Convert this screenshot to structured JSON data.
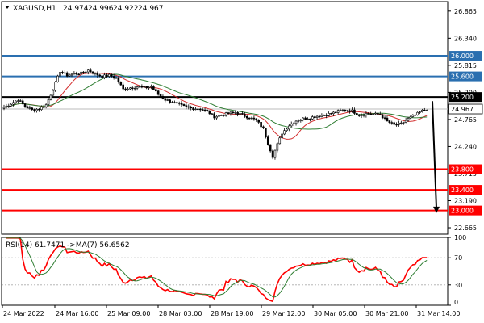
{
  "chart_data": {
    "type": "candlestick",
    "symbol": "XAGUSD,H1",
    "ohlc_header": {
      "open": "24.974",
      "high": "24.996",
      "low": "24.922",
      "close": "24.967"
    },
    "y_ticks": [
      "26.865",
      "26.340",
      "25.815",
      "25.290",
      "24.765",
      "24.240",
      "23.715",
      "23.190",
      "22.665"
    ],
    "y_range": [
      22.54,
      27.05
    ],
    "x_ticks": [
      "24 Mar 2022",
      "24 Mar 16:00",
      "25 Mar 09:00",
      "28 Mar 03:00",
      "28 Mar 19:00",
      "29 Mar 12:00",
      "30 Mar 05:00",
      "30 Mar 21:00",
      "31 Mar 14:00"
    ],
    "current_price": {
      "label": "24.967",
      "value": 24.967,
      "color": "#555555"
    },
    "levels": [
      {
        "label": "26.000",
        "value": 26.0,
        "color": "#2a6fb0"
      },
      {
        "label": "25.600",
        "value": 25.6,
        "color": "#2a6fb0"
      },
      {
        "label": "25.200",
        "value": 25.2,
        "color": "#000000"
      },
      {
        "label": "23.800",
        "value": 23.8,
        "color": "#ff0000"
      },
      {
        "label": "23.400",
        "value": 23.4,
        "color": "#ff0000"
      },
      {
        "label": "23.000",
        "value": 23.0,
        "color": "#ff0000"
      }
    ],
    "arrow": {
      "from": 25.12,
      "to": 22.95,
      "direction": "down"
    },
    "ma_colors": {
      "fast": "#d32f2f",
      "slow": "#2e7d32"
    },
    "candle_color": "#000000",
    "price_points": [
      {
        "t": 0,
        "c": 25.0
      },
      {
        "t": 3,
        "c": 25.07
      },
      {
        "t": 6,
        "c": 25.15
      },
      {
        "t": 9,
        "c": 25.02
      },
      {
        "t": 12,
        "c": 24.95
      },
      {
        "t": 15,
        "c": 24.97
      },
      {
        "t": 18,
        "c": 25.05
      },
      {
        "t": 21,
        "c": 25.35
      },
      {
        "t": 24,
        "c": 25.7
      },
      {
        "t": 27,
        "c": 25.62
      },
      {
        "t": 30,
        "c": 25.65
      },
      {
        "t": 33,
        "c": 25.66
      },
      {
        "t": 36,
        "c": 25.72
      },
      {
        "t": 39,
        "c": 25.65
      },
      {
        "t": 42,
        "c": 25.6
      },
      {
        "t": 45,
        "c": 25.62
      },
      {
        "t": 48,
        "c": 25.57
      },
      {
        "t": 51,
        "c": 25.35
      },
      {
        "t": 54,
        "c": 25.38
      },
      {
        "t": 57,
        "c": 25.4
      },
      {
        "t": 60,
        "c": 25.38
      },
      {
        "t": 63,
        "c": 25.4
      },
      {
        "t": 66,
        "c": 25.25
      },
      {
        "t": 69,
        "c": 25.15
      },
      {
        "t": 72,
        "c": 25.1
      },
      {
        "t": 75,
        "c": 25.05
      },
      {
        "t": 78,
        "c": 25.0
      },
      {
        "t": 81,
        "c": 24.98
      },
      {
        "t": 84,
        "c": 24.97
      },
      {
        "t": 87,
        "c": 24.92
      },
      {
        "t": 90,
        "c": 24.82
      },
      {
        "t": 93,
        "c": 24.85
      },
      {
        "t": 96,
        "c": 24.88
      },
      {
        "t": 99,
        "c": 24.9
      },
      {
        "t": 102,
        "c": 24.85
      },
      {
        "t": 105,
        "c": 24.8
      },
      {
        "t": 108,
        "c": 24.75
      },
      {
        "t": 111,
        "c": 24.58
      },
      {
        "t": 113,
        "c": 24.3
      },
      {
        "t": 115,
        "c": 24.05
      },
      {
        "t": 117,
        "c": 24.28
      },
      {
        "t": 119,
        "c": 24.5
      },
      {
        "t": 122,
        "c": 24.65
      },
      {
        "t": 125,
        "c": 24.74
      },
      {
        "t": 128,
        "c": 24.78
      },
      {
        "t": 131,
        "c": 24.8
      },
      {
        "t": 134,
        "c": 24.83
      },
      {
        "t": 137,
        "c": 24.85
      },
      {
        "t": 140,
        "c": 24.88
      },
      {
        "t": 143,
        "c": 24.92
      },
      {
        "t": 146,
        "c": 24.95
      },
      {
        "t": 149,
        "c": 24.93
      },
      {
        "t": 152,
        "c": 24.85
      },
      {
        "t": 155,
        "c": 24.88
      },
      {
        "t": 158,
        "c": 24.87
      },
      {
        "t": 161,
        "c": 24.86
      },
      {
        "t": 164,
        "c": 24.73
      },
      {
        "t": 167,
        "c": 24.66
      },
      {
        "t": 170,
        "c": 24.68
      },
      {
        "t": 173,
        "c": 24.78
      },
      {
        "t": 176,
        "c": 24.85
      },
      {
        "t": 179,
        "c": 24.93
      },
      {
        "t": 181,
        "c": 24.967
      }
    ],
    "rsi": {
      "label": "RSI(14) 61.7471 ->MA(7) 56.6562",
      "y_ticks": [
        "100",
        "70",
        "30",
        "0"
      ],
      "levels": [
        70,
        30
      ],
      "rsi_color": "#ff0000",
      "ma_color": "#2e7d32"
    }
  }
}
